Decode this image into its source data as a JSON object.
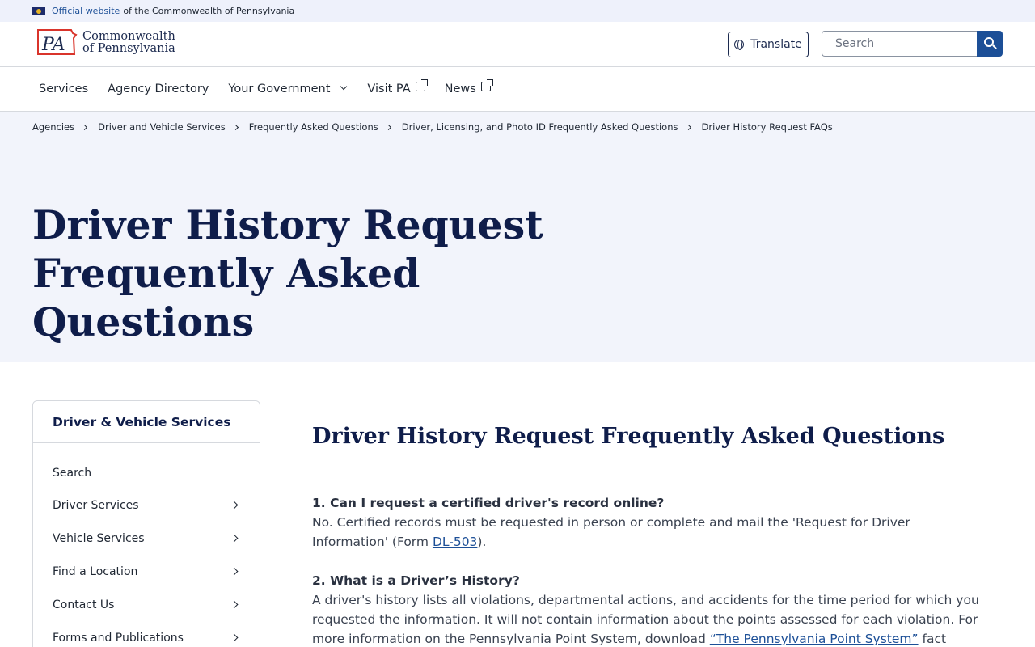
{
  "official_banner": {
    "link_text": "Official website",
    "rest_text": "of the Commonwealth of Pennsylvania"
  },
  "header": {
    "logo_mark": "PA",
    "logo_line1": "Commonwealth",
    "logo_line2": "of Pennsylvania",
    "translate_label": "Translate",
    "search_placeholder": "Search"
  },
  "nav": {
    "services": "Services",
    "agency_directory": "Agency Directory",
    "your_government": "Your Government",
    "visit_pa": "Visit PA",
    "news": "News"
  },
  "breadcrumbs": [
    {
      "label": "Agencies"
    },
    {
      "label": "Driver and Vehicle Services"
    },
    {
      "label": "Frequently Asked Questions"
    },
    {
      "label": "Driver, Licensing, and Photo ID Frequently Asked Questions"
    },
    {
      "label": "Driver History Request FAQs"
    }
  ],
  "hero": {
    "title_line1": "Driver History Request",
    "title_line2": "Frequently Asked Questions"
  },
  "sidebar": {
    "heading": "Driver & Vehicle Services",
    "items": [
      {
        "label": "Search"
      },
      {
        "label": "Driver Services"
      },
      {
        "label": "Vehicle Services"
      },
      {
        "label": "Find a Location"
      },
      {
        "label": "Contact Us"
      },
      {
        "label": "Forms and Publications"
      }
    ]
  },
  "main": {
    "title": "Driver History Request Frequently Asked Questions",
    "faqs": [
      {
        "question": "1. Can I request a certified driver's record online?",
        "answer_before": "No. Certified records must be requested in person or complete and mail the 'Request for Driver Information' (Form ",
        "answer_link": "DL-503",
        "answer_after": ")."
      },
      {
        "question": "2. What is a Driver’s History?",
        "answer_before": "A driver's history lists all violations, departmental actions, and accidents for the time period for which you requested the information. It will not contain information about the points assessed for each violation. For more information on the Pennsylvania Point System, download ",
        "answer_link": "“The Pennsylvania Point System”",
        "answer_after": " fact sheet."
      }
    ]
  },
  "colors": {
    "navy": "#0f1d4a",
    "link_blue": "#1c4f97",
    "hero_bg": "#f2f4fb",
    "banner_bg": "#eef1fb"
  }
}
